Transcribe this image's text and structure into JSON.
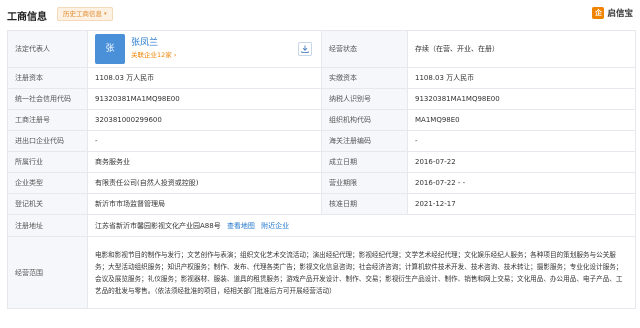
{
  "header": {
    "title": "工商信息",
    "history_tag": "历史工商信息",
    "history_caret": "▾",
    "brand_logo": "企",
    "brand_name": "启信宝"
  },
  "rows": {
    "legal_rep": {
      "label": "法定代表人",
      "avatar_text": "张",
      "name": "张凤兰",
      "related": "关联企业12家 ›",
      "download_icon": "download-icon",
      "right_label": "经营状态",
      "right_value": "存续（在营、开业、在册）"
    },
    "capital": {
      "label": "注册资本",
      "value": "1108.03 万人民币",
      "right_label": "实缴资本",
      "right_value": "1108.03 万人民币"
    },
    "credit_code": {
      "label": "统一社会信用代码",
      "value": "91320381MA1MQ98E00",
      "right_label": "纳税人识别号",
      "right_value": "91320381MA1MQ98E00"
    },
    "reg_no": {
      "label": "工商注册号",
      "value": "320381000299600",
      "right_label": "组织机构代码",
      "right_value": "MA1MQ98E0"
    },
    "import_export": {
      "label": "进出口企业代码",
      "value": "-",
      "right_label": "海关注册编码",
      "right_value": "-"
    },
    "industry": {
      "label": "所属行业",
      "value": "商务服务业",
      "right_label": "成立日期",
      "right_value": "2016-07-22"
    },
    "company_type": {
      "label": "企业类型",
      "value": "有限责任公司(自然人投资或控股)",
      "right_label": "营业期限",
      "right_value": "2016-07-22 - -"
    },
    "authority": {
      "label": "登记机关",
      "value": "新沂市市场监督管理局",
      "right_label": "核准日期",
      "right_value": "2021-12-17"
    },
    "address": {
      "label": "注册地址",
      "value": "江苏省新沂市馨园影视文化产业园A88号",
      "link_map": "查看地图",
      "link_nearby": "附近企业"
    },
    "scope": {
      "label": "经营范围",
      "text": "电影和影视节目的制作与发行；文艺创作与表演；组织文化艺术交流活动；演出经纪代理；影视经纪代理；文学艺术经纪代理；文化娱乐经纪人服务；各种项目的策划服务与公关服务；大型活动组织服务；知识产权服务；制作、发布、代理各类广告；影视文化信息咨询；社会经济咨询；计算机软件技术开发、技术咨询、技术转让；摄影服务；专业化设计服务；会议及展览服务；礼仪服务；影视器材、服装、道具的租赁服务；游戏产品开发设计、制作、交易；影视衍生产品设计、制作、销售和网上交易；文化用品、办公用品、电子产品、工艺品的批发与零售。（依法须经批准的项目，经相关部门批准后方可开展经营活动）"
    }
  }
}
